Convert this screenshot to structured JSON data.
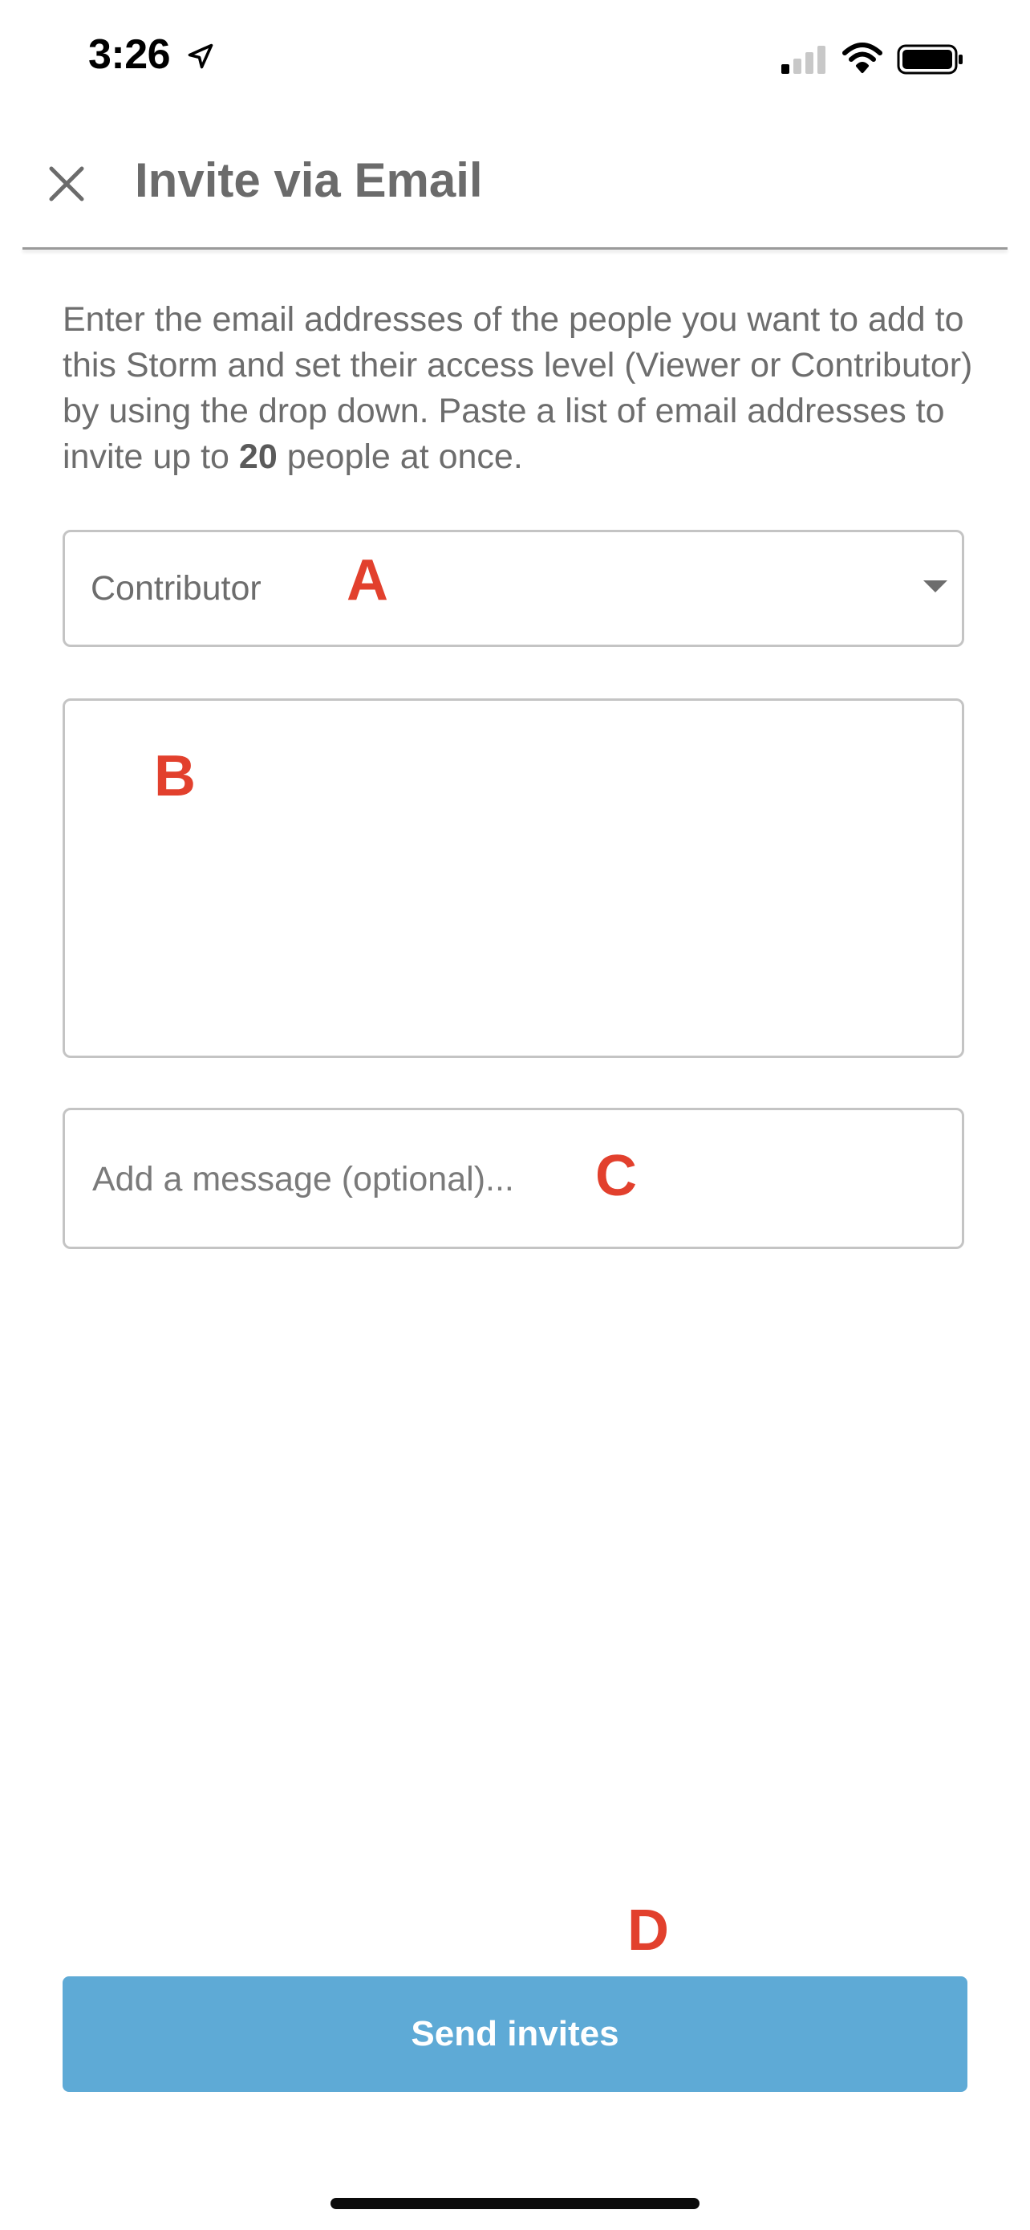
{
  "status_bar": {
    "time": "3:26",
    "location_icon": "location-arrow-icon",
    "signal_icon": "cellular-signal-icon",
    "wifi_icon": "wifi-icon",
    "battery_icon": "battery-icon"
  },
  "header": {
    "close_icon": "close-icon",
    "title": "Invite via Email"
  },
  "description": {
    "text_before": "Enter the email addresses of the people you want to add to this Storm and set their access level (Viewer or Contributor) by using the drop down. Paste a list of email addresses to invite up to ",
    "limit": "20",
    "text_after": " people at once."
  },
  "access_dropdown": {
    "selected": "Contributor",
    "caret_icon": "caret-down-icon"
  },
  "email_field": {
    "value": ""
  },
  "message_field": {
    "placeholder": "Add a message (optional)..."
  },
  "annotations": {
    "a": "A",
    "b": "B",
    "c": "C",
    "d": "D"
  },
  "send_button": {
    "label": "Send invites"
  },
  "colors": {
    "accent": "#5eaad6",
    "annotation": "#e2402d",
    "text_gray": "#6d6d6d"
  }
}
